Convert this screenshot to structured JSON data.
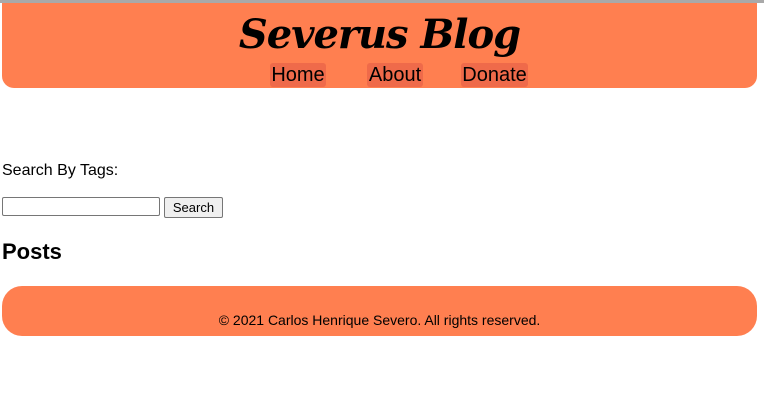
{
  "colors": {
    "header_bg": "#ff7f50",
    "nav_link_bg": "#ef6a4a",
    "footer_bg": "#ff7f50"
  },
  "header": {
    "brand": "Severus Blog",
    "nav": [
      {
        "label": "Home"
      },
      {
        "label": "About"
      },
      {
        "label": "Donate"
      }
    ]
  },
  "search": {
    "label": "Search By Tags:",
    "input_value": "",
    "button_label": "Search"
  },
  "posts": {
    "heading": "Posts"
  },
  "footer": {
    "text": "© 2021 Carlos Henrique Severo. All rights reserved."
  }
}
